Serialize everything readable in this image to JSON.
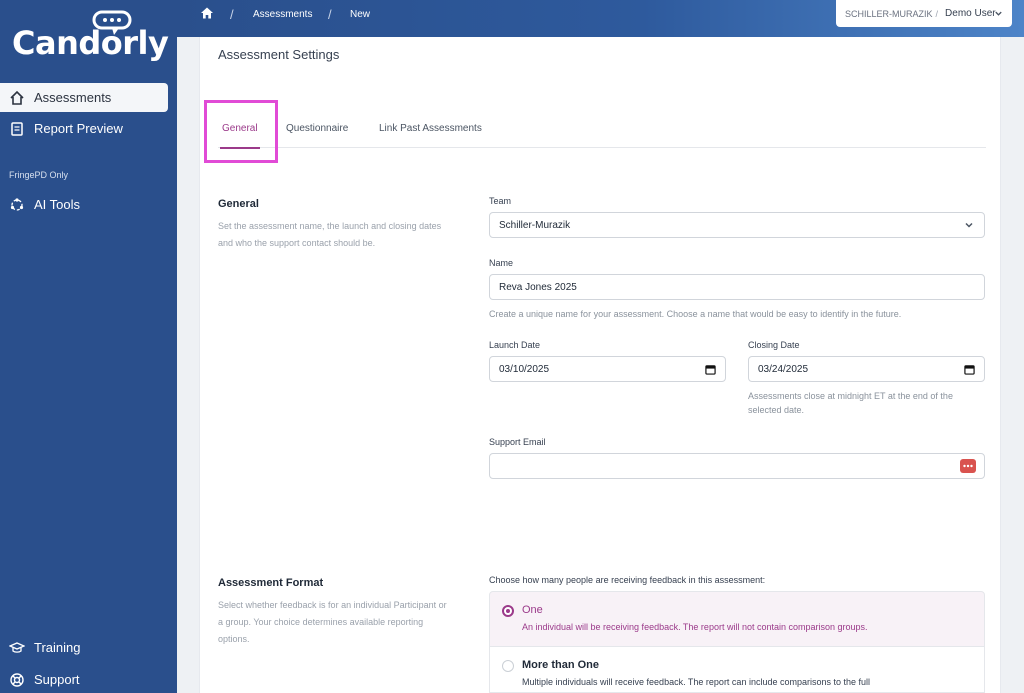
{
  "brand": {
    "name": "Candorly"
  },
  "sidebar": {
    "items": [
      {
        "label": "Assessments",
        "icon": "home-icon",
        "active": true
      },
      {
        "label": "Report Preview",
        "icon": "document-icon",
        "active": false
      }
    ],
    "section_label": "FringePD Only",
    "section_items": [
      {
        "label": "AI Tools",
        "icon": "ai-tools-icon"
      }
    ],
    "bottom_items": [
      {
        "label": "Training",
        "icon": "graduation-cap-icon"
      },
      {
        "label": "Support",
        "icon": "lifebuoy-icon"
      }
    ]
  },
  "breadcrumb": {
    "home_icon": "home-icon",
    "items": [
      "Assessments",
      "New"
    ],
    "separator": "/"
  },
  "org_selector": {
    "org": "SCHILLER-MURAZIK",
    "separator": "/",
    "user": "Demo User"
  },
  "page": {
    "title": "Assessment Settings",
    "tabs": [
      {
        "label": "General",
        "active": true
      },
      {
        "label": "Questionnaire",
        "active": false
      },
      {
        "label": "Link Past Assessments",
        "active": false
      }
    ]
  },
  "general": {
    "title": "General",
    "description": "Set the assessment name, the launch and closing dates and who the support contact should be.",
    "team": {
      "label": "Team",
      "value": "Schiller-Murazik"
    },
    "name": {
      "label": "Name",
      "value": "Reva Jones 2025",
      "help": "Create a unique name for your assessment. Choose a name that would be easy to identify in the future."
    },
    "launch_date": {
      "label": "Launch Date",
      "value": "03/10/2025"
    },
    "closing_date": {
      "label": "Closing Date",
      "value": "03/24/2025",
      "help": "Assessments close at midnight ET at the end of the selected date."
    },
    "support_email": {
      "label": "Support Email",
      "value": ""
    }
  },
  "format": {
    "title": "Assessment Format",
    "description": "Select whether feedback is for an individual Participant or a group. Your choice determines available reporting options.",
    "intro": "Choose how many people are receiving feedback in this assessment:",
    "options": [
      {
        "title": "One",
        "desc": "An individual will be receiving feedback. The report will not contain comparison groups.",
        "selected": true
      },
      {
        "title": "More than One",
        "desc": "Multiple individuals will receive feedback. The report can include comparisons to the full",
        "selected": false
      }
    ]
  },
  "colors": {
    "sidebar": "#2a4f8c",
    "accent": "#9b3a8a",
    "highlight": "#e14bd6",
    "selected_bg": "#f8f2f7"
  }
}
